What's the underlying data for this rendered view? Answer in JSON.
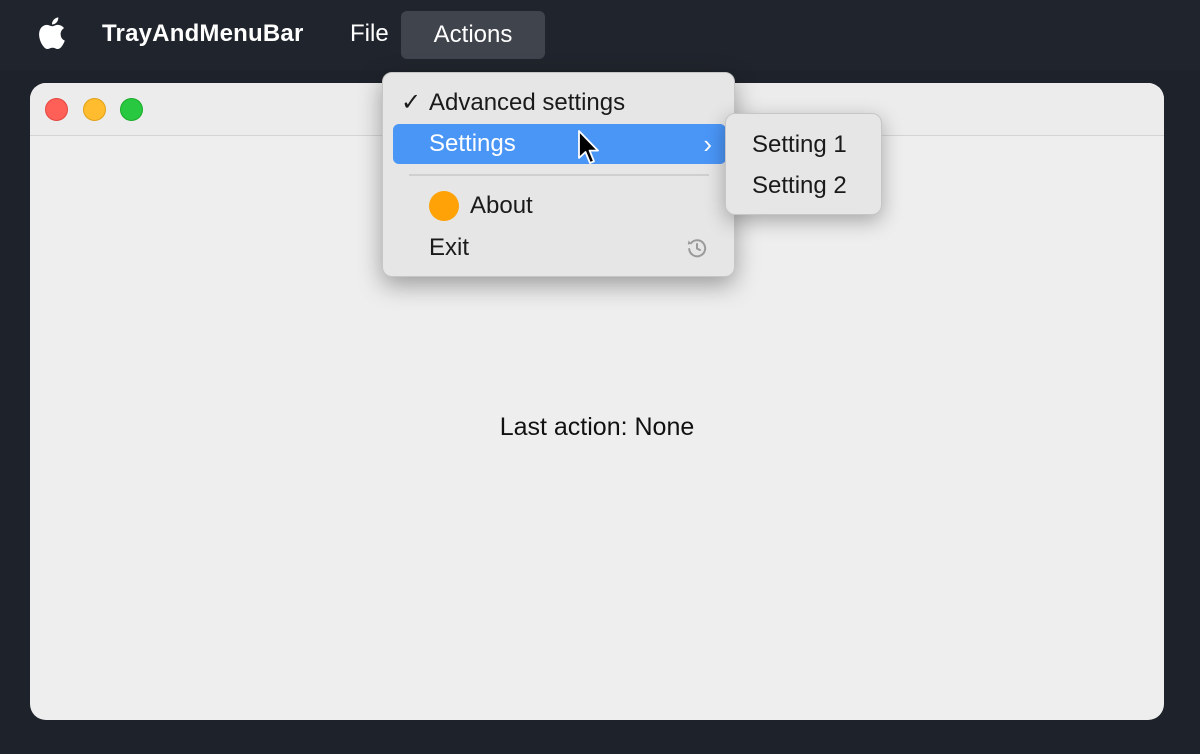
{
  "menubar": {
    "apple_icon": "apple-icon",
    "app_name": "TrayAndMenuBar",
    "menus": [
      {
        "label": "File"
      },
      {
        "label": "Actions"
      }
    ]
  },
  "window": {
    "traffic_lights": {
      "close": "#fe5f57",
      "minimize": "#febc2e",
      "maximize": "#28c840"
    },
    "status_text": "Last action: None"
  },
  "actions_menu": {
    "items": [
      {
        "label": "Advanced settings",
        "checked": true,
        "check_glyph": "✓"
      },
      {
        "label": "Settings",
        "highlighted": true,
        "has_submenu": true,
        "chevron": "›"
      },
      {
        "label": "About",
        "icon": "orange-circle-icon",
        "icon_color": "#ffa208"
      },
      {
        "label": "Exit",
        "shortcut_icon": "restore-icon"
      }
    ],
    "highlight_color": "#4a96f7"
  },
  "settings_submenu": {
    "items": [
      {
        "label": "Setting 1"
      },
      {
        "label": "Setting 2"
      }
    ]
  }
}
